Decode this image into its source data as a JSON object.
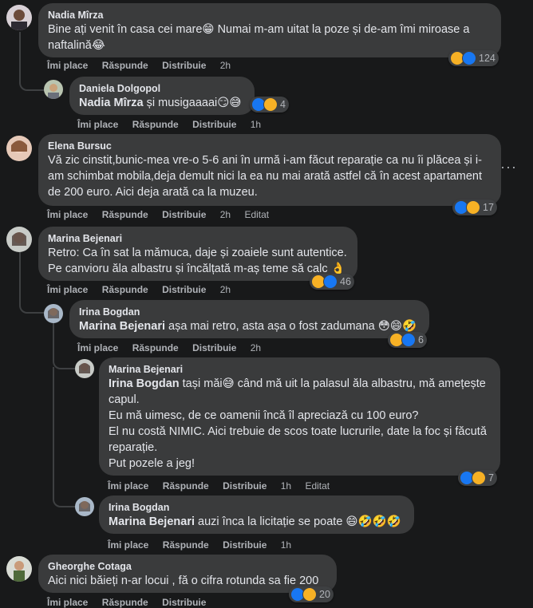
{
  "actions": {
    "like": "Îmi place",
    "reply": "Răspunde",
    "share": "Distribuie",
    "edited": "Editat"
  },
  "comments": [
    {
      "author": "Nadia Mîrza",
      "text": "Bine ați venit în casa cei mare😁 Numai m-am uitat la poze și de-am îmi miroase a naftalină😂",
      "time": "2h",
      "reactions": 124
    },
    {
      "author": "Daniela Dolgopol",
      "mention": "Nadia Mîrza",
      "text": " și musigaaaai😏😅",
      "time": "1h",
      "reactions": 4
    },
    {
      "author": "Elena Bursuc",
      "text": "Vă zic cinstit,bunic-mea vre-o 5-6 ani în urmă i-am făcut reparație ca nu îi plăcea și i-am schimbat mobila,deja demult nici la ea nu mai arată astfel că în acest apartament de 200 euro. Aici deja arată ca la muzeu.",
      "time": "2h",
      "reactions": 17
    },
    {
      "author": "Marina Bejenari",
      "line1": "Retro: Ca în sat la mămuca, daje și zoaiele sunt autentice.",
      "line2": "Pe canvioru ăla albastru și încălțată m-aș teme să calc 👌",
      "time": "2h",
      "reactions": 46
    },
    {
      "author": "Irina Bogdan",
      "mention": "Marina Bejenari",
      "text": " așa mai retro, asta așa o fost zadumana 😳😄🤣",
      "time": "2h",
      "reactions": 6
    },
    {
      "author": "Marina Bejenari",
      "mention": "Irina Bogdan",
      "line1": " tași măi😅 când mă uit la palasul ăla albastru, mă amețește capul.",
      "line2": "Eu mă uimesc, de ce oamenii încă îl apreciază cu 100 euro?",
      "line3": "El nu costă NIMIC. Aici trebuie de scos toate lucrurile, date la foc și făcută reparație.",
      "line4": "Put pozele a jeg!",
      "time": "1h",
      "reactions": 7
    },
    {
      "author": "Irina Bogdan",
      "mention": "Marina Bejenari",
      "text": " auzi înca la licitație se poate 😄🤣🤣🤣",
      "time": "1h"
    },
    {
      "author": "Gheorghe Cotaga",
      "text": "Aici nici băieți n-ar locui , fă o cifra rotunda sa fie 200",
      "reactions": 20
    }
  ],
  "colors": {
    "background": "#18191a",
    "bubble": "#3a3b3c",
    "like": "#1877f2",
    "haha": "#f7b125"
  }
}
